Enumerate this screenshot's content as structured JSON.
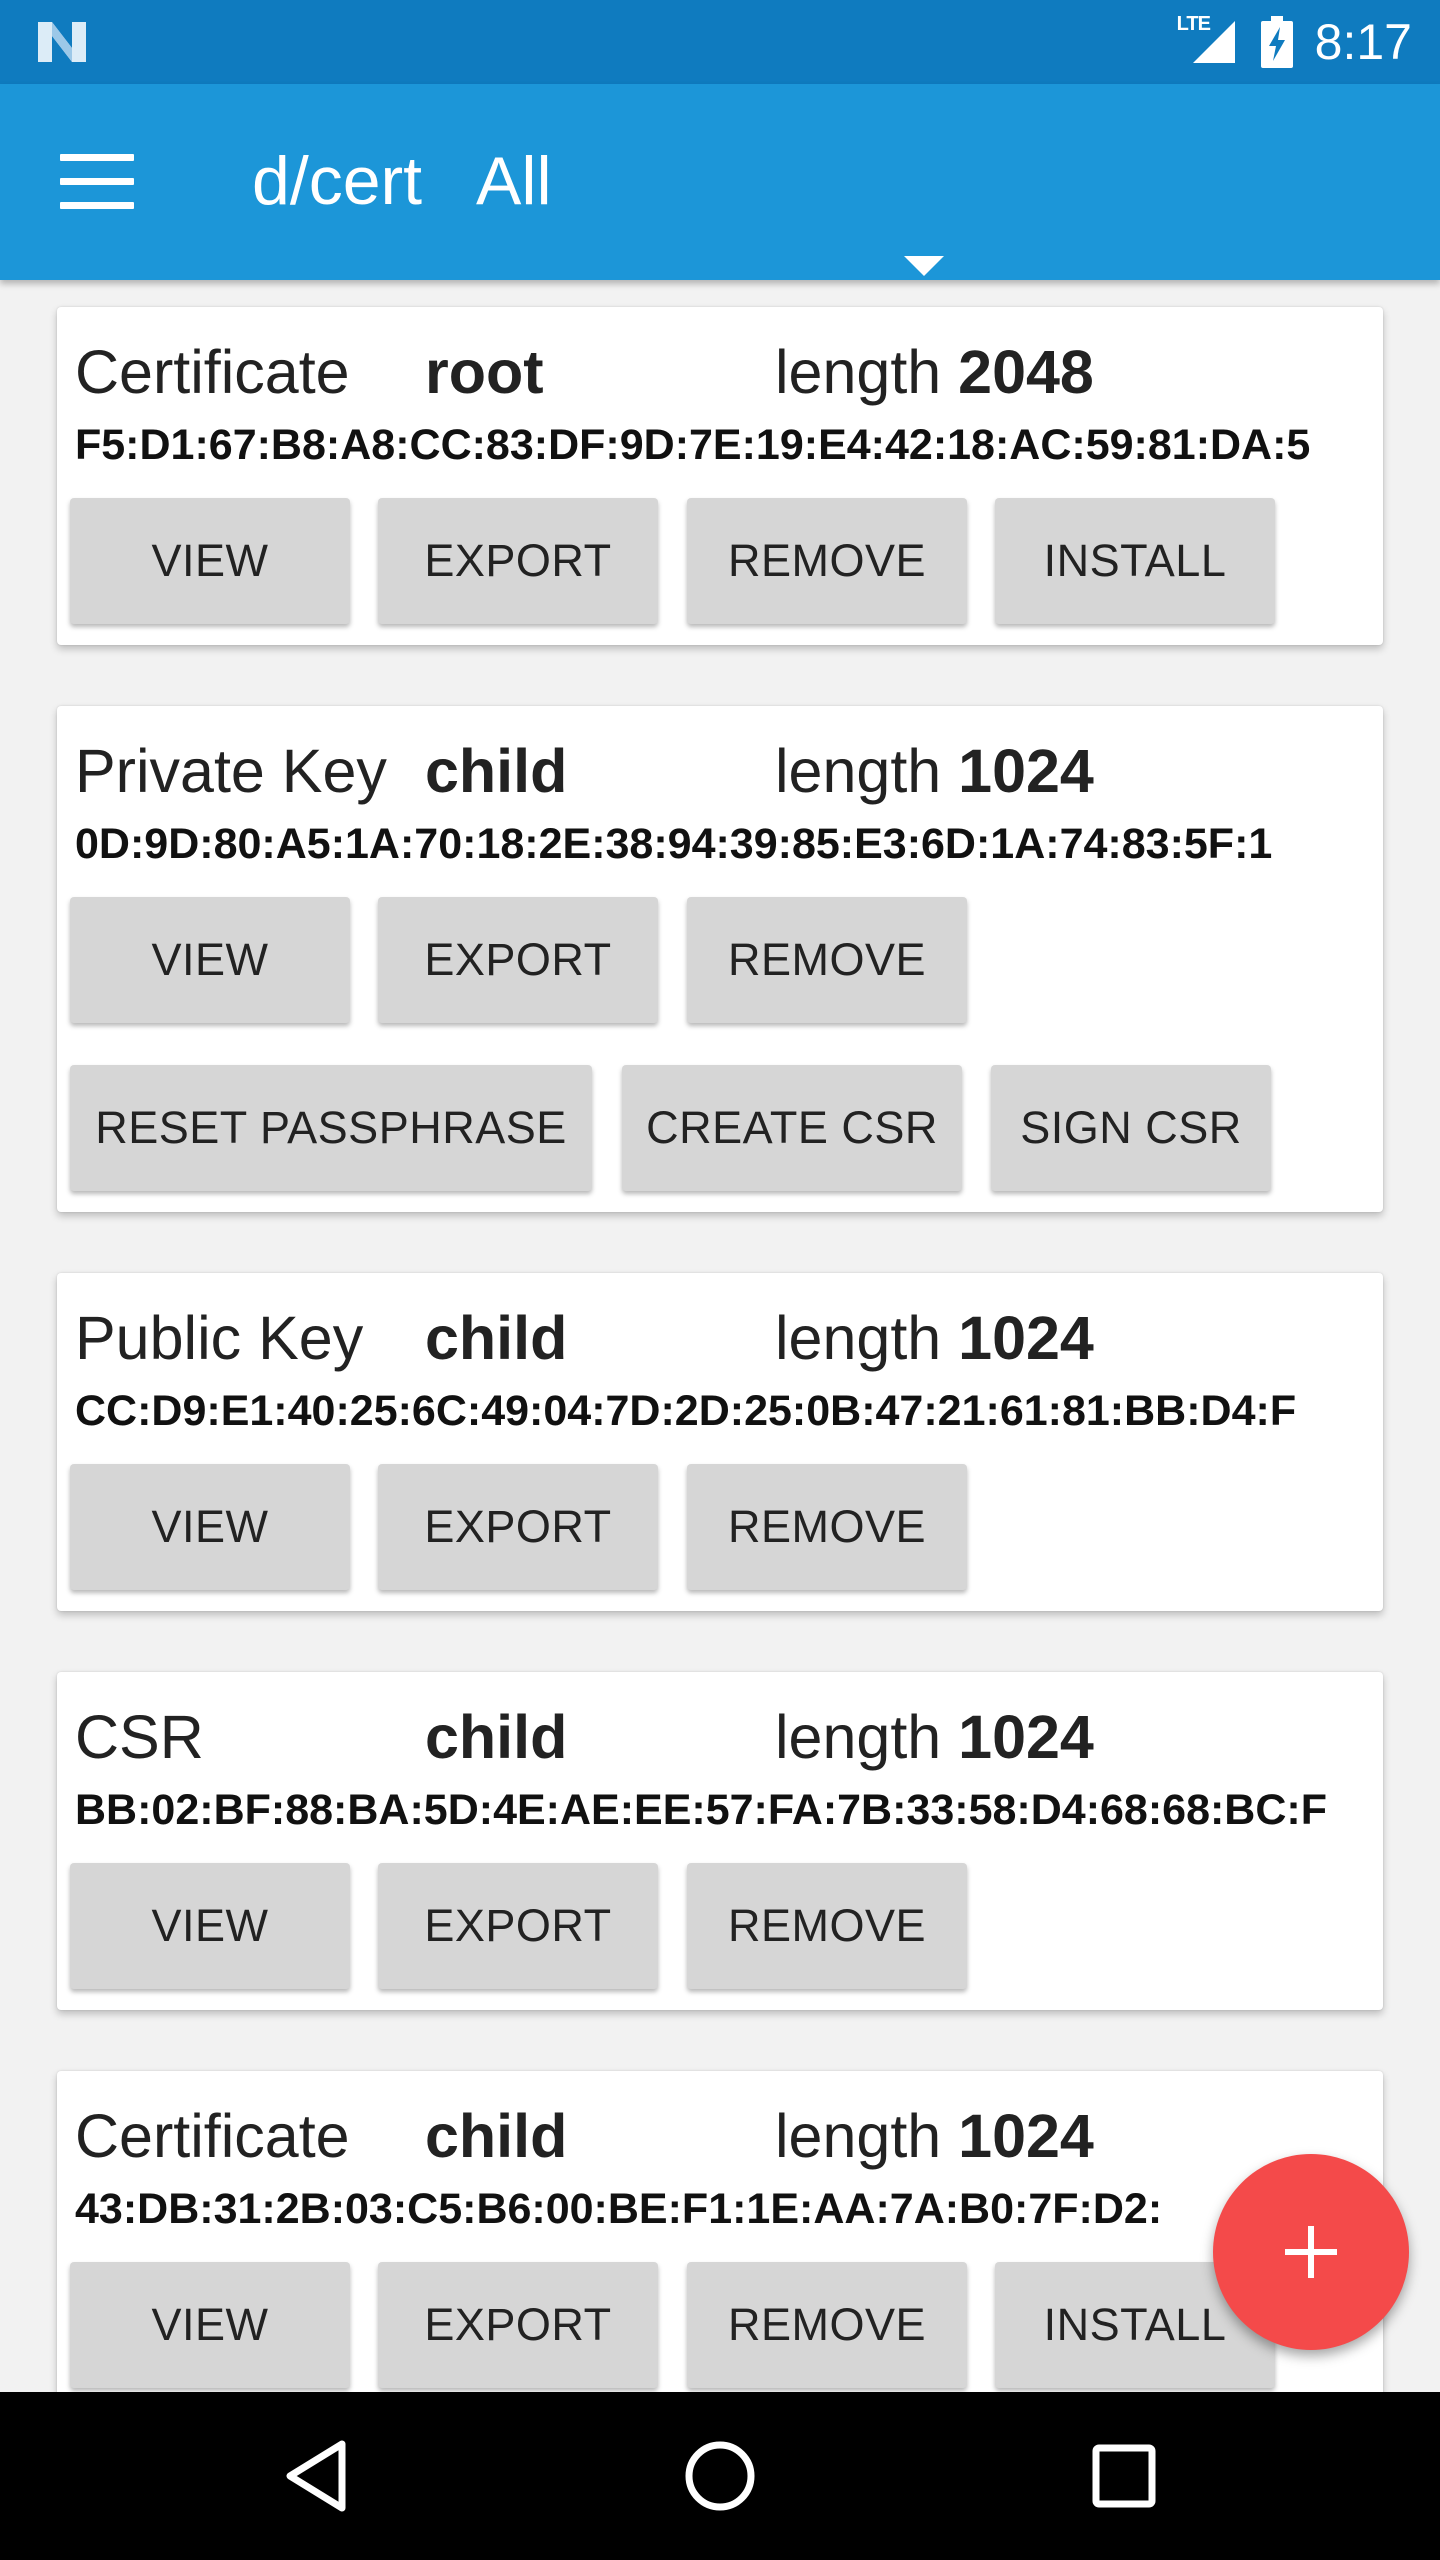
{
  "status_bar": {
    "time": "8:17",
    "network": "LTE"
  },
  "app_bar": {
    "title": "d/cert",
    "filter_value": "All"
  },
  "colors": {
    "app_bar": "#1c96d8",
    "status_bar": "#0f7bbf",
    "fab": "#f44a4a",
    "button": "#d6d6d6"
  },
  "items": [
    {
      "type": "Certificate",
      "name": "root",
      "length_label": "length",
      "length": "2048",
      "fingerprint": "F5:D1:67:B8:A8:CC:83:DF:9D:7E:19:E4:42:18:AC:59:81:DA:5",
      "buttons": [
        "VIEW",
        "EXPORT",
        "REMOVE",
        "INSTALL"
      ]
    },
    {
      "type": "Private Key",
      "name": "child",
      "length_label": "length",
      "length": "1024",
      "fingerprint": "0D:9D:80:A5:1A:70:18:2E:38:94:39:85:E3:6D:1A:74:83:5F:1",
      "buttons": [
        "VIEW",
        "EXPORT",
        "REMOVE"
      ],
      "buttons_row2": [
        "RESET PASSPHRASE",
        "CREATE CSR",
        "SIGN CSR"
      ]
    },
    {
      "type": "Public Key",
      "name": "child",
      "length_label": "length",
      "length": "1024",
      "fingerprint": "CC:D9:E1:40:25:6C:49:04:7D:2D:25:0B:47:21:61:81:BB:D4:F",
      "buttons": [
        "VIEW",
        "EXPORT",
        "REMOVE"
      ]
    },
    {
      "type": "CSR",
      "name": "child",
      "length_label": "length",
      "length": "1024",
      "fingerprint": "BB:02:BF:88:BA:5D:4E:AE:EE:57:FA:7B:33:58:D4:68:68:BC:F",
      "buttons": [
        "VIEW",
        "EXPORT",
        "REMOVE"
      ]
    },
    {
      "type": "Certificate",
      "name": "child",
      "length_label": "length",
      "length": "1024",
      "fingerprint": "43:DB:31:2B:03:C5:B6:00:BE:F1:1E:AA:7A:B0:7F:D2:",
      "buttons": [
        "VIEW",
        "EXPORT",
        "REMOVE",
        "INSTALL"
      ]
    }
  ],
  "fab": {
    "icon": "plus-icon"
  },
  "nav_bar": {
    "icons": [
      "back-icon",
      "home-icon",
      "recents-icon"
    ]
  }
}
